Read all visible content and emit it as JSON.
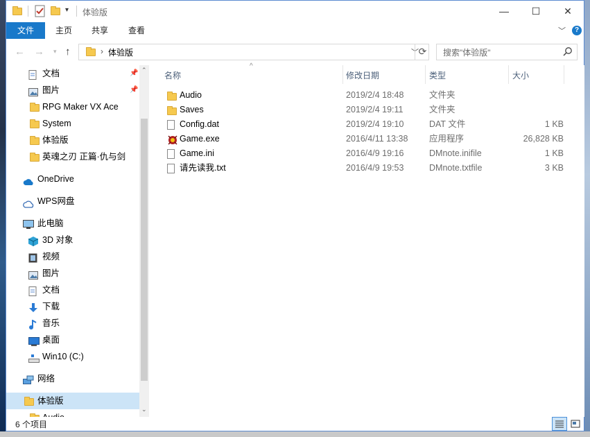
{
  "window": {
    "title": "体验版",
    "minimize_label": "—",
    "maximize_label": "☐",
    "close_label": "✕"
  },
  "ribbon": {
    "tabs": [
      "文件",
      "主页",
      "共享",
      "查看"
    ],
    "expand_icon": "chevron-down-icon",
    "help_icon": "help-icon"
  },
  "address": {
    "path": "体验版",
    "refresh_icon": "refresh-icon"
  },
  "search": {
    "placeholder": "搜索\"体验版\""
  },
  "nav": {
    "items": [
      {
        "label": "文档",
        "icon": "document-icon",
        "pinned": true
      },
      {
        "label": "图片",
        "icon": "picture-icon",
        "pinned": true
      },
      {
        "label": "RPG Maker VX Ace",
        "icon": "folder-icon"
      },
      {
        "label": "System",
        "icon": "folder-icon"
      },
      {
        "label": "体验版",
        "icon": "folder-icon"
      },
      {
        "label": "英魂之刃 正篇·仇与剑",
        "icon": "folder-icon"
      },
      {
        "label": "OneDrive",
        "icon": "cloud-icon"
      },
      {
        "label": "WPS网盘",
        "icon": "cloud-icon"
      },
      {
        "label": "此电脑",
        "icon": "computer-icon"
      },
      {
        "label": "3D 对象",
        "icon": "cube-icon"
      },
      {
        "label": "视频",
        "icon": "video-icon"
      },
      {
        "label": "图片",
        "icon": "picture-icon"
      },
      {
        "label": "文档",
        "icon": "document-icon"
      },
      {
        "label": "下载",
        "icon": "download-icon"
      },
      {
        "label": "音乐",
        "icon": "music-icon"
      },
      {
        "label": "桌面",
        "icon": "desktop-icon"
      },
      {
        "label": "Win10 (C:)",
        "icon": "drive-icon"
      },
      {
        "label": "网络",
        "icon": "network-icon"
      },
      {
        "label": "体验版",
        "icon": "folder-icon",
        "selected": true
      },
      {
        "label": "Audio",
        "icon": "folder-icon"
      }
    ]
  },
  "columns": {
    "name": "名称",
    "date": "修改日期",
    "type": "类型",
    "size": "大小"
  },
  "files": [
    {
      "name": "Audio",
      "date": "2019/2/4 18:48",
      "type": "文件夹",
      "size": "",
      "icon": "folder-icon"
    },
    {
      "name": "Saves",
      "date": "2019/2/4 19:11",
      "type": "文件夹",
      "size": "",
      "icon": "folder-icon"
    },
    {
      "name": "Config.dat",
      "date": "2019/2/4 19:10",
      "type": "DAT 文件",
      "size": "1 KB",
      "icon": "file-icon"
    },
    {
      "name": "Game.exe",
      "date": "2016/4/11 13:38",
      "type": "应用程序",
      "size": "26,828 KB",
      "icon": "app-icon"
    },
    {
      "name": "Game.ini",
      "date": "2016/4/9 19:16",
      "type": "DMnote.inifile",
      "size": "1 KB",
      "icon": "file-icon"
    },
    {
      "name": "请先读我.txt",
      "date": "2016/4/9 19:53",
      "type": "DMnote.txtfile",
      "size": "3 KB",
      "icon": "file-icon"
    }
  ],
  "status": {
    "count": "6 个项目"
  },
  "colors": {
    "accent": "#1979ca",
    "folder": "#f6c94f",
    "selection": "#cce4f7"
  }
}
